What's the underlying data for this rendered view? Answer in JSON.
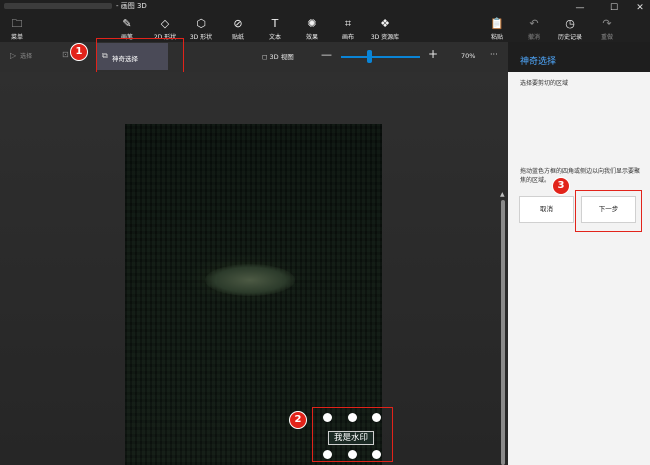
{
  "window": {
    "title": "- 画图 3D",
    "minimize_glyph": "—",
    "maximize_glyph": "☐",
    "close_glyph": "✕"
  },
  "toolbar": {
    "menu": {
      "label": "菜单",
      "icon": "folder-icon",
      "glyph": "🗀"
    },
    "tools": [
      {
        "label": "画笔",
        "icon": "brush-icon",
        "glyph": "✎"
      },
      {
        "label": "2D 形状",
        "icon": "2d-shapes-icon",
        "glyph": "◇"
      },
      {
        "label": "3D 形状",
        "icon": "3d-shapes-icon",
        "glyph": "⬡"
      },
      {
        "label": "贴纸",
        "icon": "sticker-icon",
        "glyph": "⊘"
      },
      {
        "label": "文本",
        "icon": "text-icon",
        "glyph": "T"
      },
      {
        "label": "效果",
        "icon": "effects-icon",
        "glyph": "✺"
      },
      {
        "label": "画布",
        "icon": "canvas-icon",
        "glyph": "⌗"
      },
      {
        "label": "3D 资源库",
        "icon": "3d-library-icon",
        "glyph": "❖"
      }
    ],
    "actions": [
      {
        "label": "粘贴",
        "icon": "paste-icon",
        "glyph": "📋"
      },
      {
        "label": "撤消",
        "icon": "undo-icon",
        "glyph": "↶"
      },
      {
        "label": "历史记录",
        "icon": "history-icon",
        "glyph": "◷"
      },
      {
        "label": "重做",
        "icon": "redo-icon",
        "glyph": "↷"
      }
    ]
  },
  "subtoolbar": {
    "select_label": "选择",
    "select_glyph": "▷",
    "crop_glyph": "⊡",
    "magic_select_label": "神奇选择",
    "magic_select_glyph": "⧉",
    "view3d_label": "3D 视图",
    "view3d_glyph": "◻",
    "zoom_minus": "—",
    "zoom_plus": "+",
    "zoom_value": "70%",
    "more_glyph": "···"
  },
  "canvas": {
    "watermark_text": "我是水印"
  },
  "annotations": {
    "badge1": "1",
    "badge2": "2",
    "badge3": "3"
  },
  "panel": {
    "title": "神奇选择",
    "description": "选择要剪切的区域",
    "hint": "拖动蓝色方框的四角或侧边以向我们显示要聚焦的区域。",
    "cancel_label": "取消",
    "next_label": "下一步"
  },
  "colors": {
    "accent": "#0a84d6",
    "annotation_red": "#e2231a",
    "panel_title": "#4fa9ff"
  }
}
